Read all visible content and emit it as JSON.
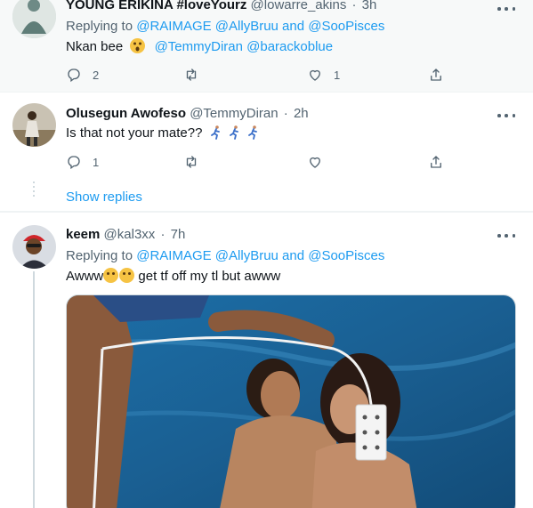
{
  "tweets": [
    {
      "display_name": "YOUNG ERIKINA #loveYourz",
      "handle": "@lowarre_akins",
      "time": "3h",
      "reply_prefix": "Replying to",
      "reply_mentions": "@RAIMAGE @AllyBruu and @SooPisces",
      "text": "Nkan bee",
      "text_emoji": "astonished-face-emoji",
      "text_mentions": "@TemmyDiran @barackoblue",
      "reply_count": "2",
      "retweet_count": "",
      "like_count": "1"
    },
    {
      "display_name": "Olusegun Awofeso",
      "handle": "@TemmyDiran",
      "time": "2h",
      "text": "Is that not your mate??",
      "text_emoji": "running-man-emoji x3",
      "reply_count": "1",
      "retweet_count": "",
      "like_count": "",
      "show_replies": "Show replies"
    },
    {
      "display_name": "keem",
      "handle": "@kal3xx",
      "time": "7h",
      "reply_prefix": "Replying to",
      "reply_mentions": "@RAIMAGE @AllyBruu and @SooPisces",
      "text_before": "Awww",
      "text_emoji": "smiling-face-emoji x2",
      "text_after": " get tf off my tl but awww"
    }
  ],
  "separator": "·",
  "colors": {
    "accent": "#1d9bf0",
    "secondary_text": "#536471",
    "primary_text": "#0f1419",
    "highlight_bg": "#f7f9f9"
  },
  "icons": [
    "reply-icon",
    "retweet-icon",
    "like-icon",
    "share-icon",
    "more-icon"
  ]
}
